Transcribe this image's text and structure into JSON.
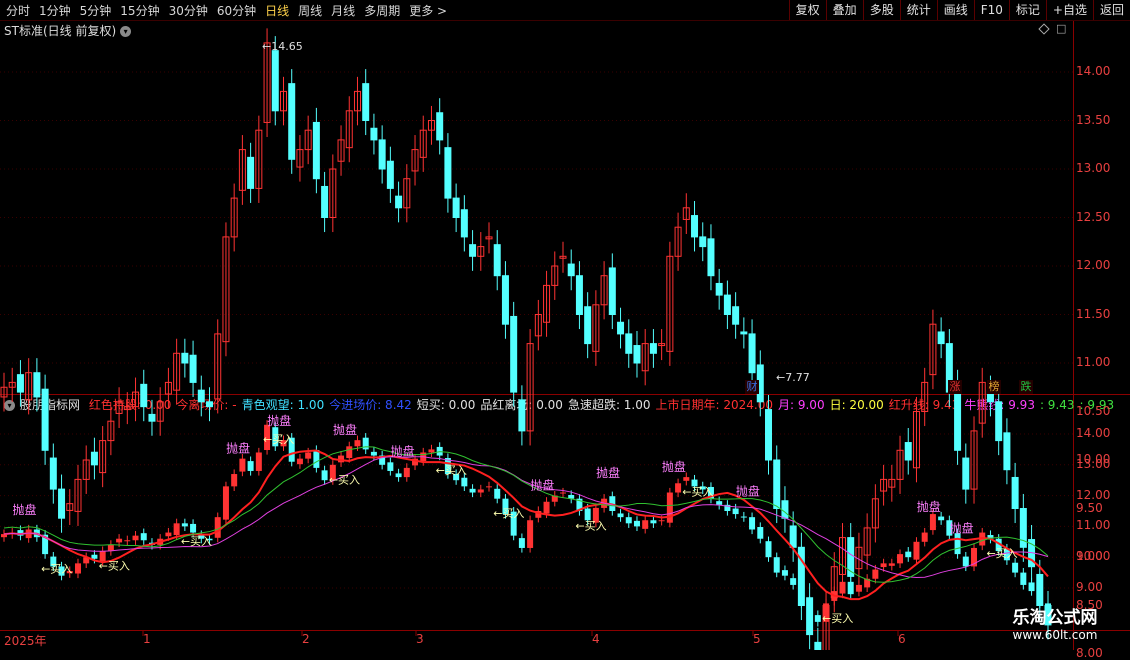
{
  "toolbar": {
    "periods": [
      "分时",
      "1分钟",
      "5分钟",
      "15分钟",
      "30分钟",
      "60分钟",
      "日线",
      "周线",
      "月线",
      "多周期",
      "更多 >"
    ],
    "active": "日线",
    "right_buttons": [
      "复权",
      "叠加",
      "多股",
      "统计",
      "画线",
      "F10",
      "标记",
      "+自选",
      "返回"
    ]
  },
  "main_chart": {
    "title": "ST标准(日线 前复权)",
    "title_icon": "chevron-down-icon",
    "high_label": "14.65",
    "low_label": "7.77",
    "badges": [
      {
        "label": "财",
        "color": "#3b6fe6"
      },
      {
        "label": "涨",
        "color": "#e23131"
      },
      {
        "label": "榜",
        "color": "#e2a431"
      },
      {
        "label": "跌",
        "color": "#20c040"
      }
    ],
    "y_ticks": [
      "14.00",
      "13.50",
      "13.00",
      "12.50",
      "12.00",
      "11.50",
      "11.00",
      "10.50",
      "10.00",
      "9.50",
      "9.00",
      "8.50",
      "8.00"
    ]
  },
  "indicator": {
    "name": "股朋指标网",
    "items": [
      {
        "text": "红色持股: 0.00",
        "color": "#ff3030"
      },
      {
        "text": "今离场价: -",
        "color": "#ff3030"
      },
      {
        "text": "青色观望: 1.00",
        "color": "#40e0ff"
      },
      {
        "text": "今进场价: 8.42",
        "color": "#3050ff"
      },
      {
        "text": "短买: 0.00",
        "color": "#e0e0e0"
      },
      {
        "text": "品红离场: 0.00",
        "color": "#e0e0e0"
      },
      {
        "text": "急速超跌: 1.00",
        "color": "#e0e0e0"
      },
      {
        "text": "上市日期年: 2024.00",
        "color": "#ff3030"
      },
      {
        "text": "月: 9.00",
        "color": "#ff40ff"
      },
      {
        "text": "日: 20.00",
        "color": "#ffff40"
      },
      {
        "text": "红升线: 9.43",
        "color": "#ff3030"
      },
      {
        "text": "牛熊线: 9.93",
        "color": "#ff40ff"
      },
      {
        "text": ": 9.43",
        "color": "#40e040"
      },
      {
        "text": ": 9.93",
        "color": "#40e040"
      }
    ],
    "y_ticks": [
      "14.00",
      "13.00",
      "12.00",
      "11.00",
      "10.00",
      "9.00"
    ],
    "signal_buy": "买入",
    "signal_sell": "抛盘"
  },
  "x_axis": [
    "2025年",
    "1",
    "2",
    "3",
    "4",
    "5",
    "6"
  ],
  "watermark": {
    "title": "乐淘公式网",
    "url": "www.60lt.com"
  },
  "colors": {
    "up": "#ff3333",
    "down": "#54ffff",
    "grid": "#8a0000"
  }
}
